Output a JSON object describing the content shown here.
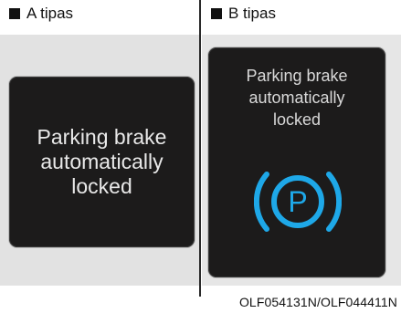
{
  "panels": {
    "a": {
      "label": "A tipas",
      "message": "Parking brake automatically locked"
    },
    "b": {
      "label": "B tipas",
      "message_lines": [
        "Parking brake",
        "automatically",
        "locked"
      ],
      "icon": "parking-brake-icon",
      "icon_letter": "P"
    }
  },
  "footer": {
    "code": "OLF054131N/OLF044411N"
  },
  "colors": {
    "screen_bg": "#1c1b1b",
    "panel_bg": "#e2e2e2",
    "icon_accent": "#1ea8e8",
    "text_light": "#e9e9e9"
  }
}
